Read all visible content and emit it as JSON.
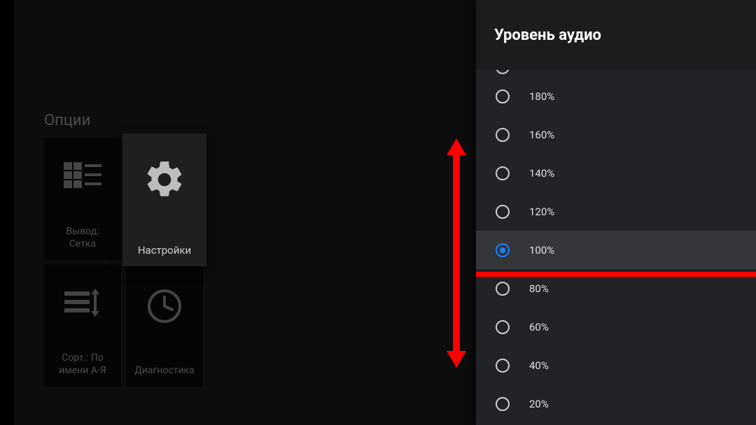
{
  "left": {
    "title": "Опции",
    "tiles": [
      {
        "label": "Вывод:\nСетка",
        "icon": "grid"
      },
      {
        "label": "Настройки",
        "icon": "gear",
        "focused": true
      },
      {
        "label": "Сорт.: По\nимени А-Я",
        "icon": "sort"
      },
      {
        "label": "Диагностика",
        "icon": "clock"
      }
    ]
  },
  "panel": {
    "title": "Уровень аудио",
    "options": [
      {
        "label": "180%",
        "value": 180,
        "selected": false
      },
      {
        "label": "160%",
        "value": 160,
        "selected": false
      },
      {
        "label": "140%",
        "value": 140,
        "selected": false
      },
      {
        "label": "120%",
        "value": 120,
        "selected": false
      },
      {
        "label": "100%",
        "value": 100,
        "selected": true
      },
      {
        "label": "80%",
        "value": 80,
        "selected": false
      },
      {
        "label": "60%",
        "value": 60,
        "selected": false
      },
      {
        "label": "40%",
        "value": 40,
        "selected": false
      },
      {
        "label": "20%",
        "value": 20,
        "selected": false
      }
    ]
  },
  "annotations": {
    "arrow_color": "#ff0000",
    "underline_color": "#ff0000"
  }
}
